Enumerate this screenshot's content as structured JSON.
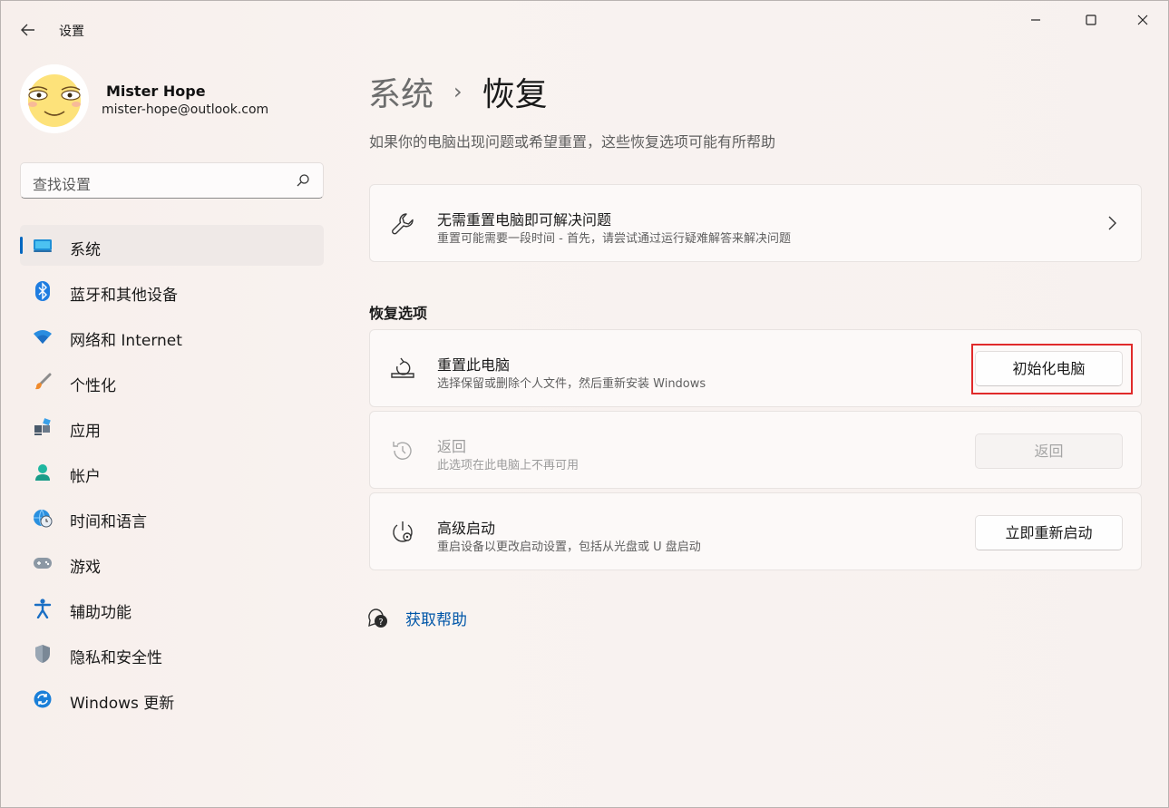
{
  "app": {
    "title": "设置"
  },
  "user": {
    "name": "Mister Hope",
    "email": "mister-hope@outlook.com"
  },
  "search": {
    "placeholder": "查找设置"
  },
  "sidebar": {
    "items": [
      {
        "label": "系统",
        "icon": "monitor-icon",
        "active": true
      },
      {
        "label": "蓝牙和其他设备",
        "icon": "bluetooth-icon"
      },
      {
        "label": "网络和 Internet",
        "icon": "wifi-icon"
      },
      {
        "label": "个性化",
        "icon": "brush-icon"
      },
      {
        "label": "应用",
        "icon": "apps-icon"
      },
      {
        "label": "帐户",
        "icon": "account-icon"
      },
      {
        "label": "时间和语言",
        "icon": "globe-clock-icon"
      },
      {
        "label": "游戏",
        "icon": "gamepad-icon"
      },
      {
        "label": "辅助功能",
        "icon": "accessibility-icon"
      },
      {
        "label": "隐私和安全性",
        "icon": "shield-icon"
      },
      {
        "label": "Windows 更新",
        "icon": "update-icon"
      }
    ]
  },
  "page": {
    "breadcrumb_parent": "系统",
    "breadcrumb_current": "恢复",
    "subtitle": "如果你的电脑出现问题或希望重置，这些恢复选项可能有所帮助"
  },
  "troubleshoot": {
    "title": "无需重置电脑即可解决问题",
    "desc": "重置可能需要一段时间 - 首先，请尝试通过运行疑难解答来解决问题"
  },
  "recovery": {
    "section_title": "恢复选项",
    "reset": {
      "title": "重置此电脑",
      "desc": "选择保留或删除个人文件，然后重新安装 Windows",
      "button": "初始化电脑"
    },
    "goback": {
      "title": "返回",
      "desc": "此选项在此电脑上不再可用",
      "button": "返回"
    },
    "advanced": {
      "title": "高级启动",
      "desc": "重启设备以更改启动设置，包括从光盘或 U 盘启动",
      "button": "立即重新启动"
    }
  },
  "help": {
    "label": "获取帮助"
  },
  "colors": {
    "accent": "#0067c0",
    "highlight": "#e02a2a",
    "link": "#0056a8"
  }
}
